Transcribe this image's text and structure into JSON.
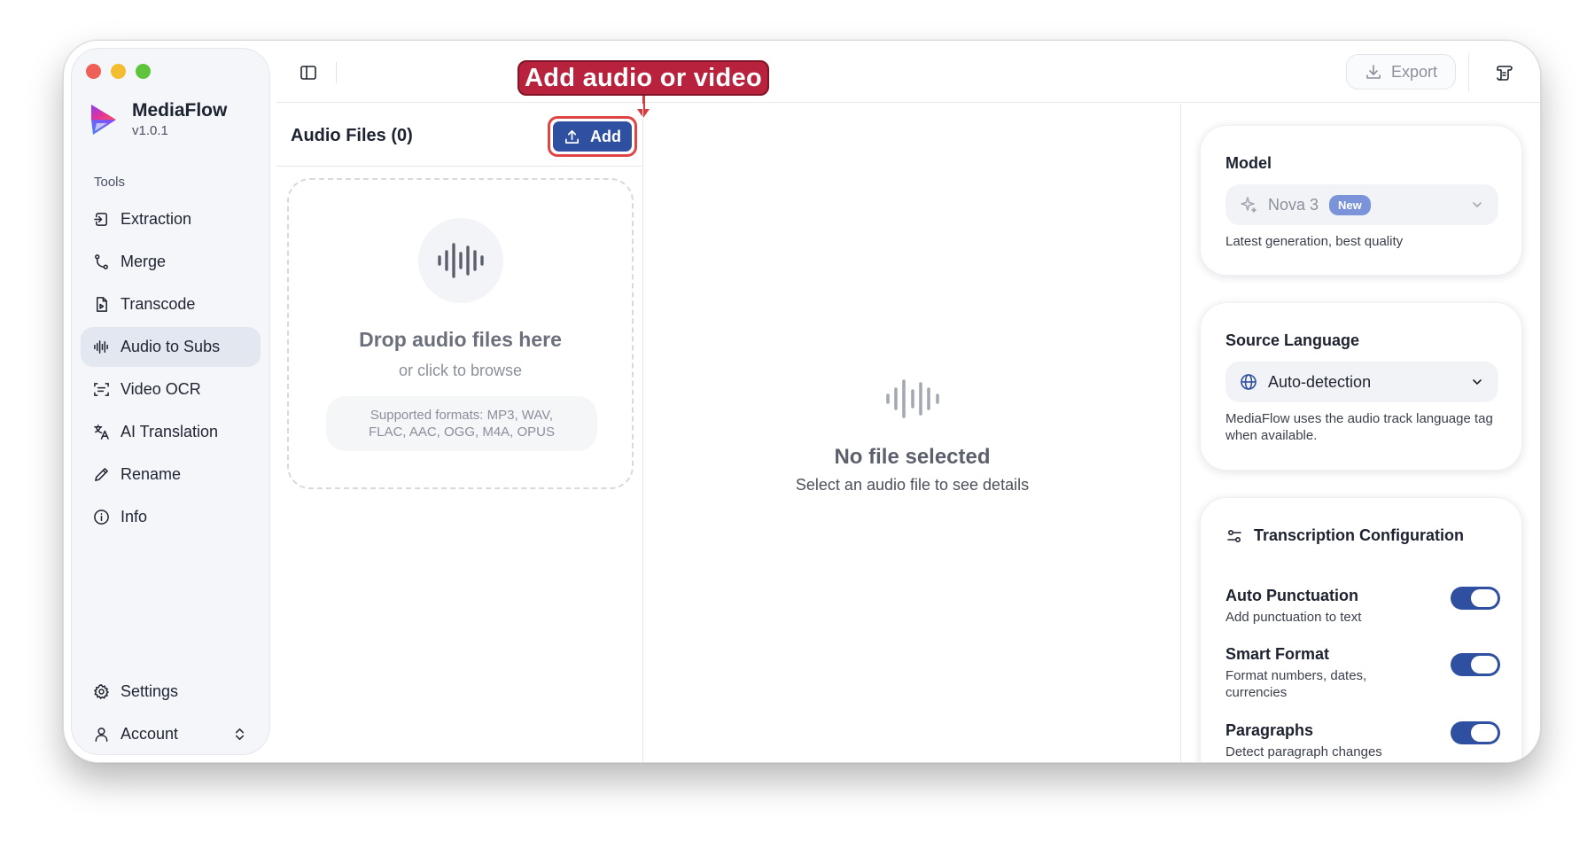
{
  "app": {
    "name": "MediaFlow",
    "version": "v1.0.1"
  },
  "sidebar": {
    "section_label": "Tools",
    "items": [
      {
        "label": "Extraction",
        "icon": "extract-icon",
        "active": false
      },
      {
        "label": "Merge",
        "icon": "merge-icon",
        "active": false
      },
      {
        "label": "Transcode",
        "icon": "transcode-icon",
        "active": false
      },
      {
        "label": "Audio to Subs",
        "icon": "audio-wave-icon",
        "active": true
      },
      {
        "label": "Video OCR",
        "icon": "ocr-icon",
        "active": false
      },
      {
        "label": "AI Translation",
        "icon": "translate-icon",
        "active": false
      },
      {
        "label": "Rename",
        "icon": "pencil-icon",
        "active": false
      },
      {
        "label": "Info",
        "icon": "info-icon",
        "active": false
      }
    ],
    "bottom": {
      "settings_label": "Settings",
      "account_label": "Account"
    }
  },
  "topbar": {
    "export_label": "Export"
  },
  "callout": {
    "text": "Add audio or video"
  },
  "files": {
    "title": "Audio Files (0)",
    "add_label": "Add",
    "dropzone": {
      "title": "Drop audio files here",
      "subtitle": "or click to browse",
      "formats_line1": "Supported formats: MP3, WAV,",
      "formats_line2": "FLAC, AAC, OGG, M4A, OPUS"
    }
  },
  "detail": {
    "title": "No file selected",
    "subtitle": "Select an audio file to see details"
  },
  "settings": {
    "model": {
      "label": "Model",
      "value": "Nova 3",
      "badge": "New",
      "help": "Latest generation, best quality"
    },
    "language": {
      "label": "Source Language",
      "value": "Auto-detection",
      "help": "MediaFlow uses the audio track language tag when available."
    },
    "config": {
      "title": "Transcription Configuration",
      "options": [
        {
          "title": "Auto Punctuation",
          "desc": "Add punctuation to text",
          "enabled": true
        },
        {
          "title": "Smart Format",
          "desc": "Format numbers, dates, currencies",
          "enabled": true
        },
        {
          "title": "Paragraphs",
          "desc": "Detect paragraph changes",
          "enabled": true
        }
      ]
    }
  },
  "colors": {
    "accent": "#2f4fa0",
    "callout": "#b8223d",
    "callout_border": "#e04545",
    "badge": "#7b93d8"
  }
}
